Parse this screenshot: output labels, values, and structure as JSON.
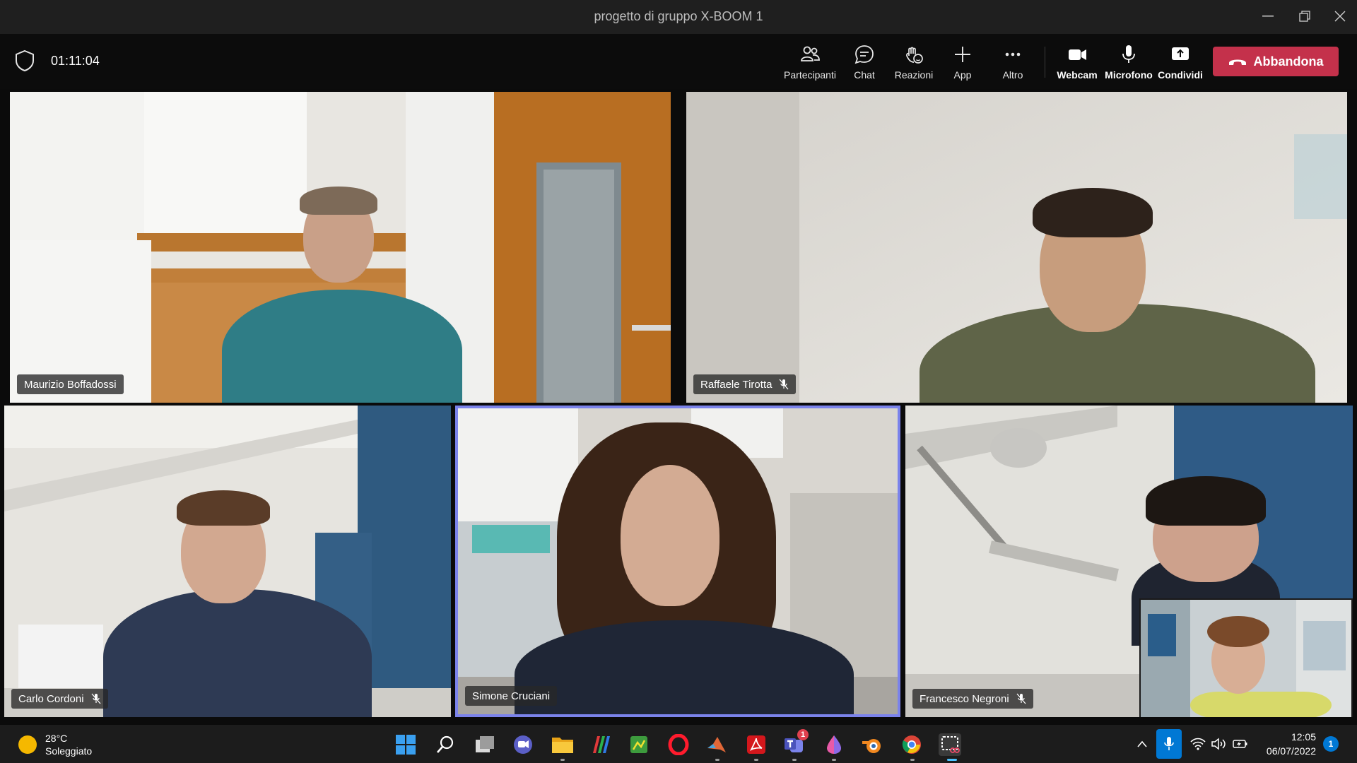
{
  "window": {
    "title": "progetto di gruppo X-BOOM 1",
    "controls": [
      "minimize",
      "restore",
      "close"
    ]
  },
  "meeting": {
    "timer": "01:11:04",
    "buttons": {
      "participants": "Partecipanti",
      "chat": "Chat",
      "reactions": "Reazioni",
      "apps": "App",
      "more": "Altro",
      "webcam": "Webcam",
      "microphone": "Microfono",
      "share": "Condividi"
    },
    "leave_label": "Abbandona"
  },
  "participants": [
    {
      "name": "Maurizio Boffadossi",
      "muted": false
    },
    {
      "name": "Raffaele Tirotta",
      "muted": true
    },
    {
      "name": "Carlo Cordoni",
      "muted": true
    },
    {
      "name": "Simone Cruciani",
      "muted": false,
      "active_speaker": true
    },
    {
      "name": "Francesco Negroni",
      "muted": true
    }
  ],
  "taskbar": {
    "weather": {
      "temp": "28°C",
      "condition": "Soleggiato"
    },
    "apps": [
      "start-icon",
      "search-icon",
      "task-view-icon",
      "teams-chat-icon",
      "file-explorer-icon",
      "app-stripes-icon",
      "app-green-icon",
      "opera-icon",
      "matlab-icon",
      "acrobat-icon",
      "teams-icon",
      "drop-app-icon",
      "blender-icon",
      "chrome-icon",
      "snipping-tool-icon"
    ],
    "teams_badge": "1",
    "clock": {
      "time": "12:05",
      "date": "06/07/2022"
    },
    "notification_count": "1"
  },
  "colors": {
    "leave": "#c4314b",
    "active_speaker_border": "#7b83eb",
    "mic_tray_highlight": "#0078d4"
  }
}
